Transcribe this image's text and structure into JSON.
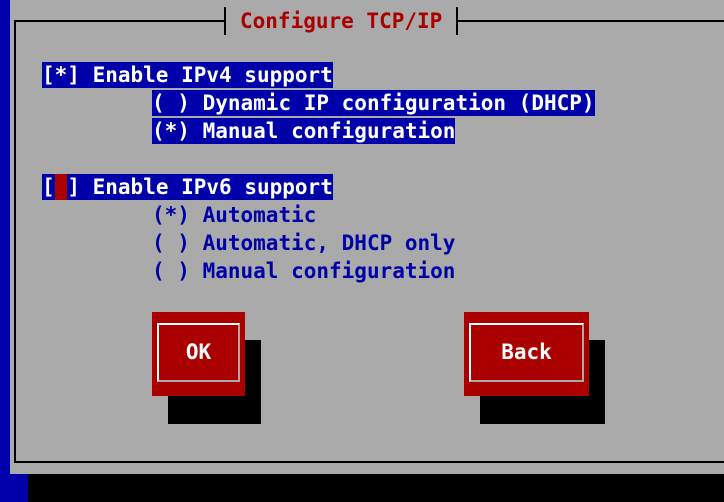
{
  "dialog": {
    "title": "Configure TCP/IP"
  },
  "ipv4": {
    "checkbox": "[*]",
    "label": "Enable IPv4 support",
    "options": [
      {
        "marker": "( )",
        "label": "Dynamic IP configuration (DHCP)"
      },
      {
        "marker": "(*)",
        "label": "Manual configuration"
      }
    ]
  },
  "ipv6": {
    "checkbox_open": "[",
    "checkbox_mark": " ",
    "checkbox_close": "]",
    "label": "Enable IPv6 support",
    "options": [
      {
        "marker": "(*)",
        "label": "Automatic"
      },
      {
        "marker": "( )",
        "label": "Automatic, DHCP only"
      },
      {
        "marker": "( )",
        "label": "Manual configuration"
      }
    ]
  },
  "buttons": {
    "ok": "OK",
    "back": "Back"
  },
  "colors": {
    "screen_bg": "#0000aa",
    "dialog_bg": "#aaaaaa",
    "title": "#aa0000",
    "button": "#aa0000",
    "selected_bg": "#0000aa",
    "text": "#0000aa"
  }
}
